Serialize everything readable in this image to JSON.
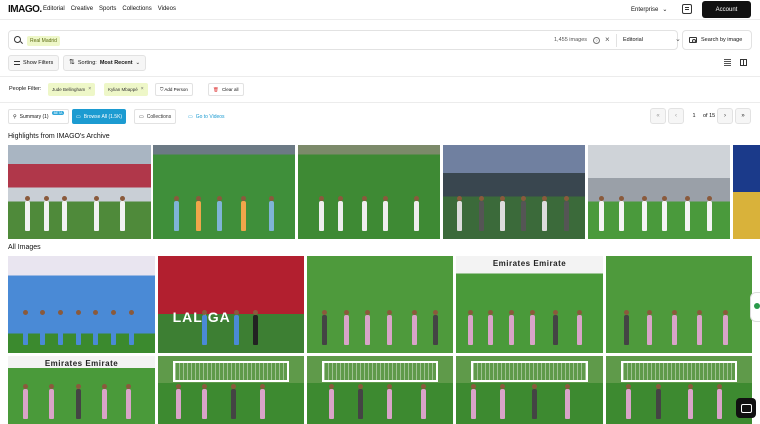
{
  "brand": {
    "logo": "IMAGO."
  },
  "nav": {
    "links": [
      "Editorial",
      "Creative",
      "Sports",
      "Collections",
      "Videos"
    ],
    "enterprise": "Enterprise",
    "account": "Account"
  },
  "search": {
    "query": "Real Madrid",
    "count": "1,455 images",
    "help": "?",
    "clear": "×",
    "collection": "Editorial",
    "image_search": "Search by image"
  },
  "toolbar": {
    "show_filters": "Show Filters",
    "sorting_prefix": "Sorting:",
    "sorting_value": "Most Recent"
  },
  "people_filter": {
    "label": "People Filter:",
    "people": [
      "Jude Bellingham",
      "Kylian Mbappé"
    ],
    "add_person": "Add Person",
    "clear_all": "Clear all"
  },
  "tabs": {
    "summary": "Summary (1)",
    "beta": "BETA",
    "browse_all": "Browse All (1.5K)",
    "collections": "Collections",
    "go_to_videos": "Go to Videos"
  },
  "pagination": {
    "current": "1",
    "of": "of 15"
  },
  "sections": {
    "highlights": "Highlights from IMAGO's Archive",
    "all_images": "All Images"
  },
  "photo_text": {
    "emirates": "Emirates  Emirate",
    "laliga": "LALIGA"
  },
  "colors": {
    "accent": "#1c9bd1",
    "chip": "#eef7c8",
    "dark": "#111111"
  }
}
